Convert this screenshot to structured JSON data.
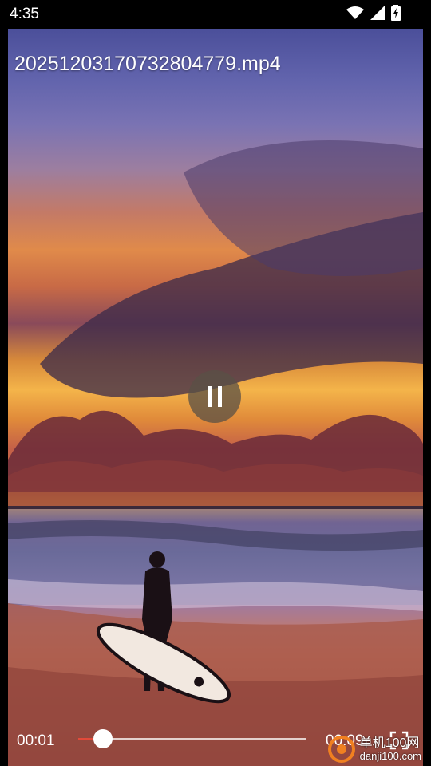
{
  "status_bar": {
    "time": "4:35",
    "icons": [
      "wifi-icon",
      "cellular-signal-icon",
      "battery-charging-icon"
    ]
  },
  "player": {
    "title": "20251203170732804779.mp4",
    "play_state_icon": "pause-icon",
    "current_time": "00:01",
    "total_time": "00:09",
    "progress": 0.11,
    "accent_color": "#e24a3a"
  },
  "watermark": {
    "line1": "单机100网",
    "line2": "danji100.com"
  }
}
